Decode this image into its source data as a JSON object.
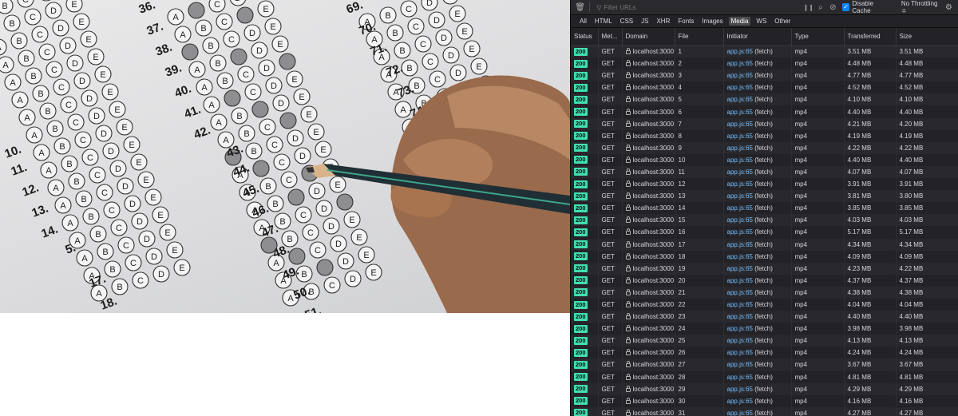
{
  "devtools": {
    "filter_placeholder": "Filter URLs",
    "disable_cache_label": "Disable Cache",
    "throttling_label": "No Throttling ≑",
    "filter_tabs": [
      "All",
      "HTML",
      "CSS",
      "JS",
      "XHR",
      "Fonts",
      "Images",
      "Media",
      "WS",
      "Other"
    ],
    "active_tab": "Media",
    "columns": [
      "Status",
      "Met...",
      "Domain",
      "File",
      "Initiator",
      "Type",
      "Transferred",
      "Size"
    ],
    "requests": [
      {
        "status": "200",
        "method": "GET",
        "domain": "localhost:3000",
        "file": "1",
        "initiator": "app.js:65",
        "initiator_suffix": "(fetch)",
        "type": "mp4",
        "transferred": "3.51 MB",
        "size": "3.51 MB"
      },
      {
        "status": "200",
        "method": "GET",
        "domain": "localhost:3000",
        "file": "2",
        "initiator": "app.js:65",
        "initiator_suffix": "(fetch)",
        "type": "mp4",
        "transferred": "4.48 MB",
        "size": "4.48 MB"
      },
      {
        "status": "200",
        "method": "GET",
        "domain": "localhost:3000",
        "file": "3",
        "initiator": "app.js:65",
        "initiator_suffix": "(fetch)",
        "type": "mp4",
        "transferred": "4.77 MB",
        "size": "4.77 MB"
      },
      {
        "status": "200",
        "method": "GET",
        "domain": "localhost:3000",
        "file": "4",
        "initiator": "app.js:65",
        "initiator_suffix": "(fetch)",
        "type": "mp4",
        "transferred": "4.52 MB",
        "size": "4.52 MB"
      },
      {
        "status": "200",
        "method": "GET",
        "domain": "localhost:3000",
        "file": "5",
        "initiator": "app.js:65",
        "initiator_suffix": "(fetch)",
        "type": "mp4",
        "transferred": "4.10 MB",
        "size": "4.10 MB"
      },
      {
        "status": "200",
        "method": "GET",
        "domain": "localhost:3000",
        "file": "6",
        "initiator": "app.js:65",
        "initiator_suffix": "(fetch)",
        "type": "mp4",
        "transferred": "4.40 MB",
        "size": "4.40 MB"
      },
      {
        "status": "200",
        "method": "GET",
        "domain": "localhost:3000",
        "file": "7",
        "initiator": "app.js:65",
        "initiator_suffix": "(fetch)",
        "type": "mp4",
        "transferred": "4.21 MB",
        "size": "4.20 MB"
      },
      {
        "status": "200",
        "method": "GET",
        "domain": "localhost:3000",
        "file": "8",
        "initiator": "app.js:65",
        "initiator_suffix": "(fetch)",
        "type": "mp4",
        "transferred": "4.19 MB",
        "size": "4.19 MB"
      },
      {
        "status": "200",
        "method": "GET",
        "domain": "localhost:3000",
        "file": "9",
        "initiator": "app.js:65",
        "initiator_suffix": "(fetch)",
        "type": "mp4",
        "transferred": "4.22 MB",
        "size": "4.22 MB"
      },
      {
        "status": "200",
        "method": "GET",
        "domain": "localhost:3000",
        "file": "10",
        "initiator": "app.js:65",
        "initiator_suffix": "(fetch)",
        "type": "mp4",
        "transferred": "4.40 MB",
        "size": "4.40 MB"
      },
      {
        "status": "200",
        "method": "GET",
        "domain": "localhost:3000",
        "file": "11",
        "initiator": "app.js:65",
        "initiator_suffix": "(fetch)",
        "type": "mp4",
        "transferred": "4.07 MB",
        "size": "4.07 MB"
      },
      {
        "status": "200",
        "method": "GET",
        "domain": "localhost:3000",
        "file": "12",
        "initiator": "app.js:65",
        "initiator_suffix": "(fetch)",
        "type": "mp4",
        "transferred": "3.91 MB",
        "size": "3.91 MB"
      },
      {
        "status": "200",
        "method": "GET",
        "domain": "localhost:3000",
        "file": "13",
        "initiator": "app.js:65",
        "initiator_suffix": "(fetch)",
        "type": "mp4",
        "transferred": "3.81 MB",
        "size": "3.80 MB"
      },
      {
        "status": "200",
        "method": "GET",
        "domain": "localhost:3000",
        "file": "14",
        "initiator": "app.js:65",
        "initiator_suffix": "(fetch)",
        "type": "mp4",
        "transferred": "3.85 MB",
        "size": "3.85 MB"
      },
      {
        "status": "200",
        "method": "GET",
        "domain": "localhost:3000",
        "file": "15",
        "initiator": "app.js:65",
        "initiator_suffix": "(fetch)",
        "type": "mp4",
        "transferred": "4.03 MB",
        "size": "4.03 MB"
      },
      {
        "status": "200",
        "method": "GET",
        "domain": "localhost:3000",
        "file": "16",
        "initiator": "app.js:65",
        "initiator_suffix": "(fetch)",
        "type": "mp4",
        "transferred": "5.17 MB",
        "size": "5.17 MB"
      },
      {
        "status": "200",
        "method": "GET",
        "domain": "localhost:3000",
        "file": "17",
        "initiator": "app.js:65",
        "initiator_suffix": "(fetch)",
        "type": "mp4",
        "transferred": "4.34 MB",
        "size": "4.34 MB"
      },
      {
        "status": "200",
        "method": "GET",
        "domain": "localhost:3000",
        "file": "18",
        "initiator": "app.js:65",
        "initiator_suffix": "(fetch)",
        "type": "mp4",
        "transferred": "4.09 MB",
        "size": "4.09 MB"
      },
      {
        "status": "200",
        "method": "GET",
        "domain": "localhost:3000",
        "file": "19",
        "initiator": "app.js:65",
        "initiator_suffix": "(fetch)",
        "type": "mp4",
        "transferred": "4.23 MB",
        "size": "4.22 MB"
      },
      {
        "status": "200",
        "method": "GET",
        "domain": "localhost:3000",
        "file": "20",
        "initiator": "app.js:65",
        "initiator_suffix": "(fetch)",
        "type": "mp4",
        "transferred": "4.37 MB",
        "size": "4.37 MB"
      },
      {
        "status": "200",
        "method": "GET",
        "domain": "localhost:3000",
        "file": "21",
        "initiator": "app.js:65",
        "initiator_suffix": "(fetch)",
        "type": "mp4",
        "transferred": "4.38 MB",
        "size": "4.38 MB"
      },
      {
        "status": "200",
        "method": "GET",
        "domain": "localhost:3000",
        "file": "22",
        "initiator": "app.js:65",
        "initiator_suffix": "(fetch)",
        "type": "mp4",
        "transferred": "4.04 MB",
        "size": "4.04 MB"
      },
      {
        "status": "200",
        "method": "GET",
        "domain": "localhost:3000",
        "file": "23",
        "initiator": "app.js:65",
        "initiator_suffix": "(fetch)",
        "type": "mp4",
        "transferred": "4.40 MB",
        "size": "4.40 MB"
      },
      {
        "status": "200",
        "method": "GET",
        "domain": "localhost:3000",
        "file": "24",
        "initiator": "app.js:65",
        "initiator_suffix": "(fetch)",
        "type": "mp4",
        "transferred": "3.98 MB",
        "size": "3.98 MB"
      },
      {
        "status": "200",
        "method": "GET",
        "domain": "localhost:3000",
        "file": "25",
        "initiator": "app.js:65",
        "initiator_suffix": "(fetch)",
        "type": "mp4",
        "transferred": "4.13 MB",
        "size": "4.13 MB"
      },
      {
        "status": "200",
        "method": "GET",
        "domain": "localhost:3000",
        "file": "26",
        "initiator": "app.js:65",
        "initiator_suffix": "(fetch)",
        "type": "mp4",
        "transferred": "4.24 MB",
        "size": "4.24 MB"
      },
      {
        "status": "200",
        "method": "GET",
        "domain": "localhost:3000",
        "file": "27",
        "initiator": "app.js:65",
        "initiator_suffix": "(fetch)",
        "type": "mp4",
        "transferred": "3.67 MB",
        "size": "3.67 MB"
      },
      {
        "status": "200",
        "method": "GET",
        "domain": "localhost:3000",
        "file": "28",
        "initiator": "app.js:65",
        "initiator_suffix": "(fetch)",
        "type": "mp4",
        "transferred": "4.81 MB",
        "size": "4.81 MB"
      },
      {
        "status": "200",
        "method": "GET",
        "domain": "localhost:3000",
        "file": "29",
        "initiator": "app.js:65",
        "initiator_suffix": "(fetch)",
        "type": "mp4",
        "transferred": "4.29 MB",
        "size": "4.29 MB"
      },
      {
        "status": "200",
        "method": "GET",
        "domain": "localhost:3000",
        "file": "30",
        "initiator": "app.js:65",
        "initiator_suffix": "(fetch)",
        "type": "mp4",
        "transferred": "4.16 MB",
        "size": "4.16 MB"
      },
      {
        "status": "200",
        "method": "GET",
        "domain": "localhost:3000",
        "file": "31",
        "initiator": "app.js:65",
        "initiator_suffix": "(fetch)",
        "type": "mp4",
        "transferred": "4.27 MB",
        "size": "4.27 MB"
      }
    ]
  },
  "photo": {
    "question_numbers": [
      "36.",
      "37.",
      "38.",
      "39.",
      "40.",
      "41.",
      "42.",
      "43.",
      "44.",
      "45.",
      "46.",
      "47.",
      "48.",
      "49.",
      "50.",
      "51.",
      "69.",
      "70.",
      "71.",
      "72.",
      "73.",
      "74.",
      "75.",
      "10.",
      "11.",
      "12.",
      "13.",
      "14.",
      "5.",
      "17.",
      "18."
    ],
    "answer_letters": [
      "A",
      "B",
      "C",
      "D",
      "E"
    ]
  }
}
